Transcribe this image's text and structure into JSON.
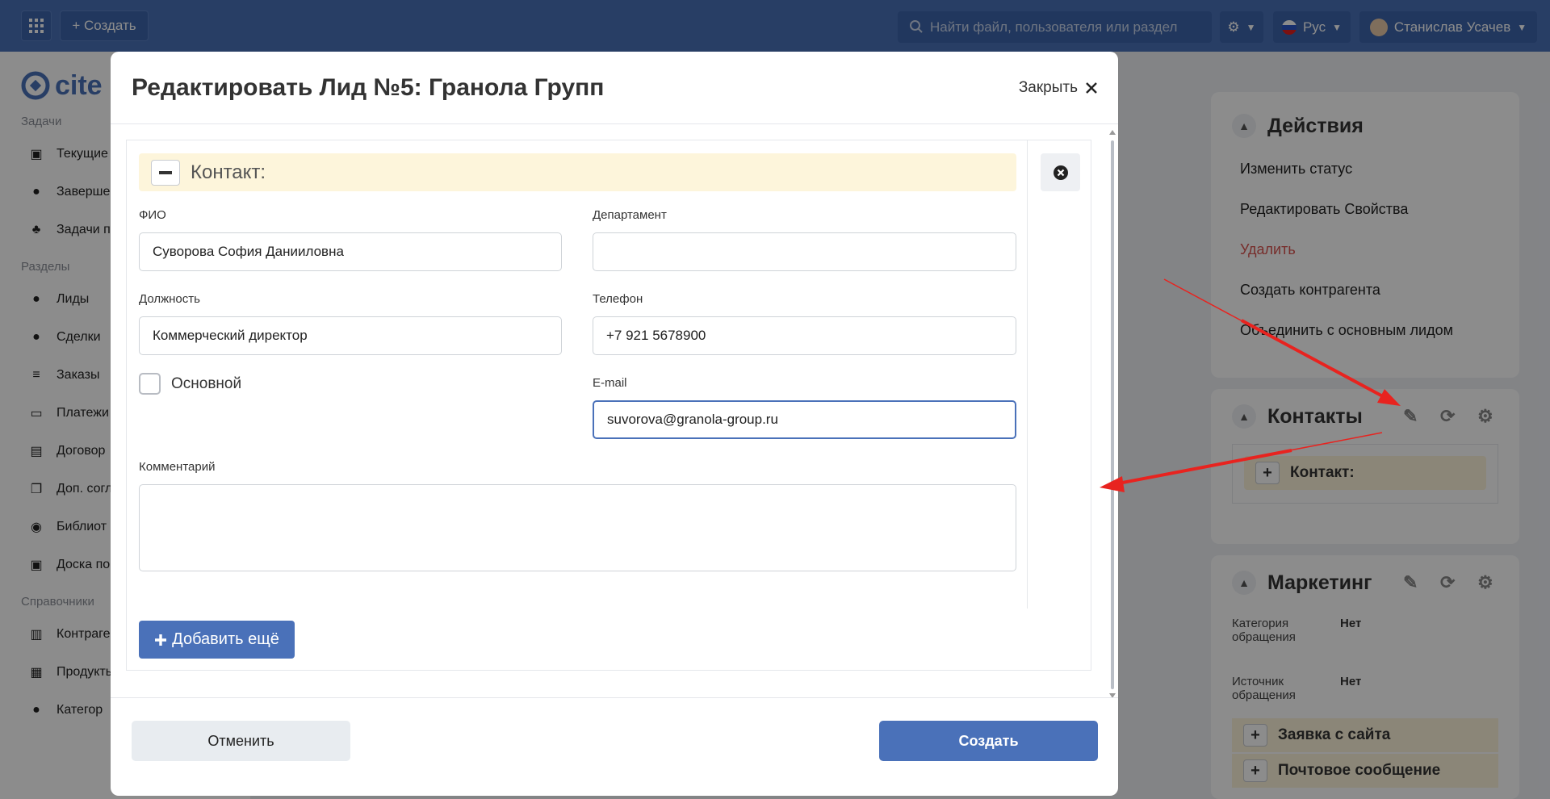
{
  "topbar": {
    "create_label": "+ Создать",
    "search_placeholder": "Найти файл, пользователя или раздел",
    "lang_label": "Рус",
    "user_name": "Станислав Усачев"
  },
  "sidebar": {
    "logo_text": "cite",
    "sections": [
      {
        "title": "Задачи",
        "items": [
          "Текущие",
          "Заверше",
          "Задачи п"
        ]
      },
      {
        "title": "Разделы",
        "items": [
          "Лиды",
          "Сделки",
          "Заказы",
          "Платежи",
          "Договор",
          "Доп. согл",
          "Библиот",
          "Доска по"
        ]
      },
      {
        "title": "Справочники",
        "items": [
          "Контраге",
          "Продукты",
          "Категор"
        ]
      }
    ]
  },
  "actions_panel": {
    "title": "Действия",
    "items": [
      "Изменить статус",
      "Редактировать Свойства",
      "Удалить",
      "Создать контрагента",
      "Объединить с основным лидом"
    ],
    "danger_color": "#d9534f"
  },
  "contacts_panel": {
    "title": "Контакты",
    "contact_label": "Контакт:"
  },
  "marketing_panel": {
    "title": "Маркетинг",
    "rows": [
      {
        "label": "Категория обращения",
        "value": "Нет"
      },
      {
        "label": "Источник обращения",
        "value": "Нет"
      }
    ],
    "items": [
      "Заявка с сайта",
      "Почтовое сообщение"
    ]
  },
  "modal": {
    "title": "Редактировать Лид №5: Гранола Групп",
    "close_label": "Закрыть",
    "contact_section_label": "Контакт:",
    "fields": {
      "fio_label": "ФИО",
      "fio_value": "Суворова София Данииловна",
      "department_label": "Департамент",
      "department_value": "",
      "position_label": "Должность",
      "position_value": "Коммерческий директор",
      "phone_label": "Телефон",
      "phone_value": "+7 921 5678900",
      "primary_label": "Основной",
      "primary_checked": false,
      "email_label": "E-mail",
      "email_value": "suvorova@granola-group.ru",
      "comment_label": "Комментарий",
      "comment_value": ""
    },
    "add_more_label": "Добавить ещё",
    "cancel_label": "Отменить",
    "create_label": "Создать"
  },
  "colors": {
    "primary": "#4a71b9",
    "contact_bar": "#fdf5db",
    "annotation_arrow": "#e8231f"
  }
}
